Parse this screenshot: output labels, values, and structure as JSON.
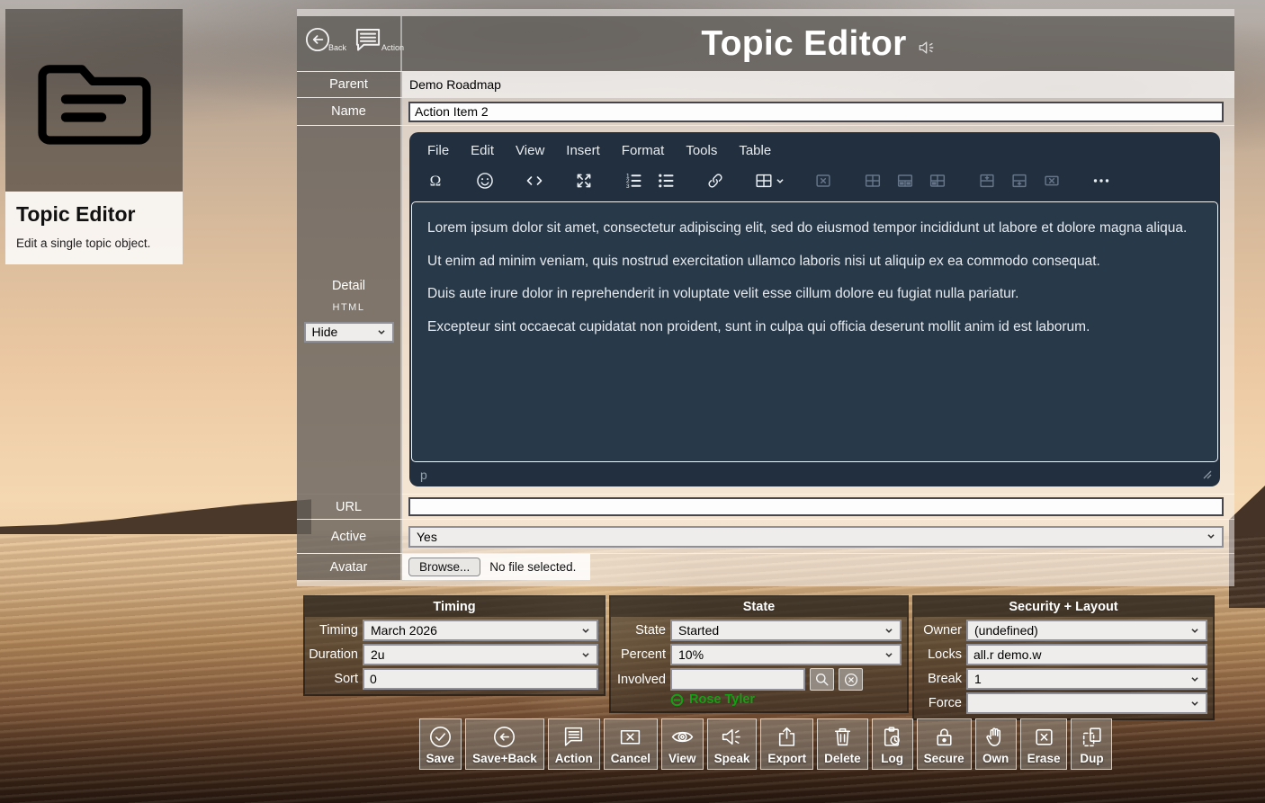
{
  "card": {
    "title": "Topic Editor",
    "subtitle": "Edit a single topic object."
  },
  "header": {
    "title": "Topic Editor",
    "back_label": "Back",
    "action_label": "Action",
    "icons": [
      "arrow-left-circle",
      "speech-bubble",
      "speaker-mute"
    ]
  },
  "form": {
    "parent": {
      "label": "Parent",
      "value": "Demo Roadmap"
    },
    "name": {
      "label": "Name",
      "value": "Action Item 2"
    },
    "detail": {
      "label": "Detail",
      "sublabel": "HTML",
      "visibility_value": "Hide"
    },
    "url": {
      "label": "URL",
      "value": ""
    },
    "active": {
      "label": "Active",
      "value": "Yes"
    },
    "avatar": {
      "label": "Avatar",
      "browse_label": "Browse...",
      "file_status": "No file selected."
    }
  },
  "editor": {
    "menu": [
      "File",
      "Edit",
      "View",
      "Insert",
      "Format",
      "Tools",
      "Table"
    ],
    "toolbar_icons": [
      "special-character",
      "emoticon",
      "source-code",
      "fullscreen",
      "ordered-list",
      "bullet-list",
      "link",
      "table",
      "table-delete",
      "table-cell-properties",
      "table-row-properties",
      "table-merge-cells",
      "table-insert-row-above",
      "table-insert-row-below",
      "table-delete-row",
      "more-options"
    ],
    "paragraphs": [
      "Lorem ipsum dolor sit amet, consectetur adipiscing elit, sed do eiusmod tempor incididunt ut labore et dolore magna aliqua.",
      "Ut enim ad minim veniam, quis nostrud exercitation ullamco laboris nisi ut aliquip ex ea commodo consequat.",
      "Duis aute irure dolor in reprehenderit in voluptate velit esse cillum dolore eu fugiat nulla pariatur.",
      "Excepteur sint occaecat cupidatat non proident, sunt in culpa qui officia deserunt mollit anim id est laborum."
    ],
    "element_path": "p"
  },
  "panels": {
    "timing": {
      "title": "Timing",
      "rows": [
        {
          "label": "Timing",
          "value": "March 2026"
        },
        {
          "label": "Duration",
          "value": "2u"
        },
        {
          "label": "Sort",
          "value": "0"
        }
      ]
    },
    "state": {
      "title": "State",
      "rows": [
        {
          "label": "State",
          "value": "Started"
        },
        {
          "label": "Percent",
          "value": "10%"
        }
      ],
      "involved_label": "Involved",
      "involved_value": "",
      "member": "Rose Tyler"
    },
    "security": {
      "title": "Security + Layout",
      "rows": [
        {
          "label": "Owner",
          "value": "(undefined)"
        },
        {
          "label": "Locks",
          "value": "all.r demo.w"
        },
        {
          "label": "Break",
          "value": "1"
        },
        {
          "label": "Force",
          "value": ""
        }
      ]
    }
  },
  "toolbar": {
    "buttons": [
      {
        "label": "Save",
        "icon": "check-circle"
      },
      {
        "label": "Save+Back",
        "icon": "arrow-left-circle"
      },
      {
        "label": "Action",
        "icon": "speech-bubble"
      },
      {
        "label": "Cancel",
        "icon": "x-rectangle"
      },
      {
        "label": "View",
        "icon": "eye"
      },
      {
        "label": "Speak",
        "icon": "speaker"
      },
      {
        "label": "Export",
        "icon": "share-up"
      },
      {
        "label": "Delete",
        "icon": "trash"
      },
      {
        "label": "Log",
        "icon": "clipboard-clock"
      },
      {
        "label": "Secure",
        "icon": "padlock"
      },
      {
        "label": "Own",
        "icon": "hand"
      },
      {
        "label": "Erase",
        "icon": "x-box"
      },
      {
        "label": "Dup",
        "icon": "duplicate"
      }
    ]
  }
}
